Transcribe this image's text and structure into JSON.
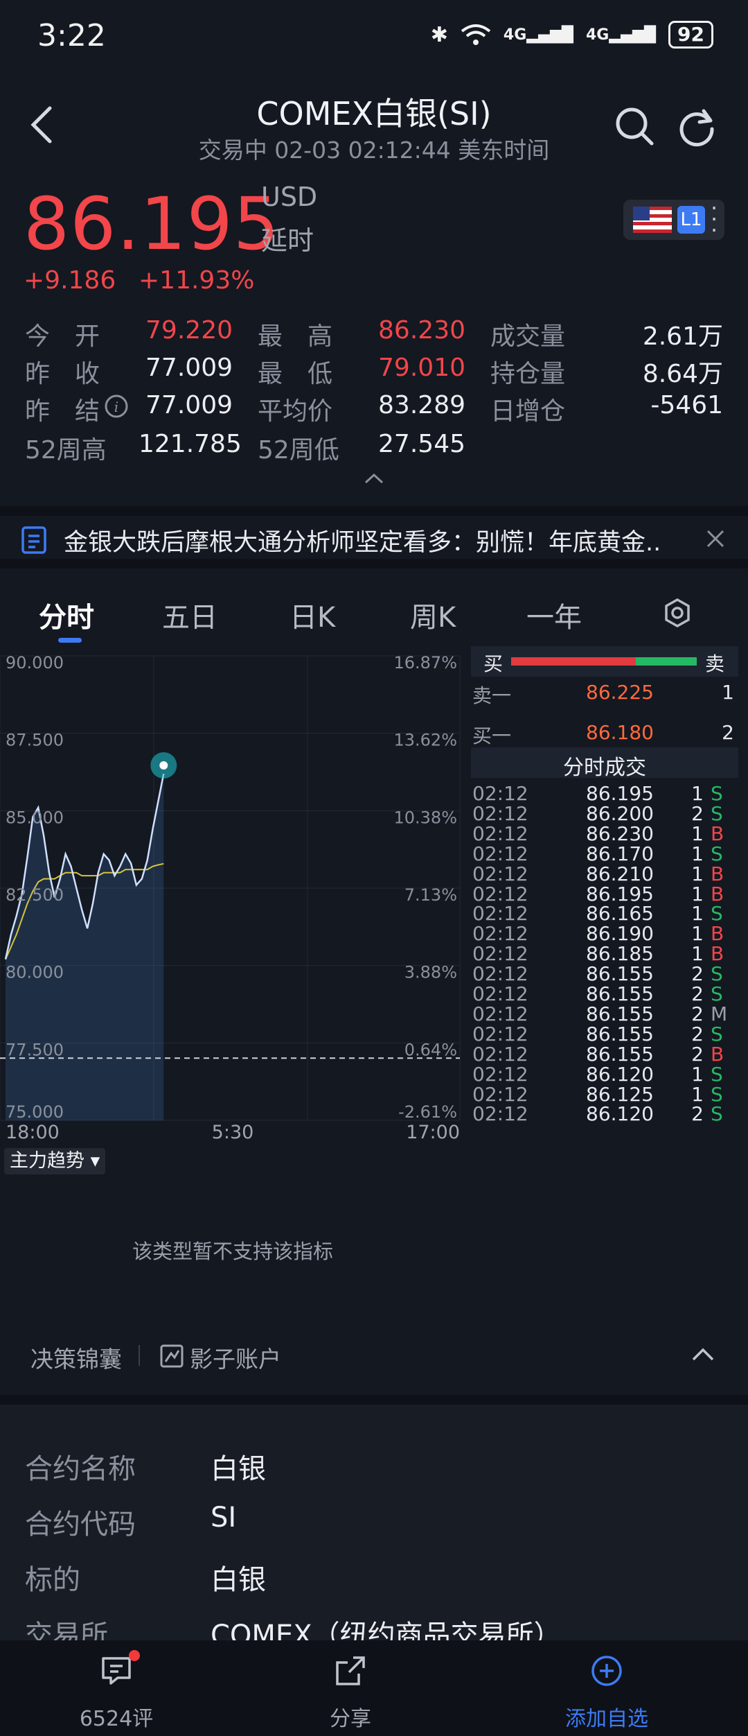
{
  "status": {
    "time": "3:22",
    "battery": "92",
    "net1": "4G",
    "net2": "4G"
  },
  "header": {
    "title": "COMEX白银(SI)",
    "subtitle": "交易中 02-03 02:12:44 美东时间"
  },
  "quote": {
    "price": "86.195",
    "currency": "USD",
    "delay": "延时",
    "change": "+9.186",
    "change_pct": "+11.93%",
    "badge_level": "L1"
  },
  "stats": {
    "open_label": "今　开",
    "open": "79.220",
    "high_label": "最　高",
    "high": "86.230",
    "volume_label": "成交量",
    "volume": "2.61万",
    "prev_close_label": "昨　收",
    "prev_close": "77.009",
    "low_label": "最　低",
    "low": "79.010",
    "oi_label": "持仓量",
    "oi": "8.64万",
    "prev_settle_label": "昨　结",
    "prev_settle": "77.009",
    "avg_label": "平均价",
    "avg": "83.289",
    "oi_change_label": "日增仓",
    "oi_change": "-5461",
    "w52_high_label": "52周高",
    "w52_high": "121.785",
    "w52_low_label": "52周低",
    "w52_low": "27.545"
  },
  "news": {
    "text": "金银大跌后摩根大通分析师坚定看多：别慌！年底黄金..."
  },
  "tabs": [
    "分时",
    "五日",
    "日K",
    "周K",
    "一年"
  ],
  "chart": {
    "y_labels": [
      "90.000",
      "87.500",
      "85.000",
      "82.500",
      "80.000",
      "77.500",
      "75.000"
    ],
    "pct_labels": [
      "16.87%",
      "13.62%",
      "10.38%",
      "7.13%",
      "3.88%",
      "0.64%",
      "-2.61%"
    ],
    "x_labels": [
      "18:00",
      "5:30",
      "17:00"
    ],
    "indicator_label": "主力趋势",
    "indicator_msg": "该类型暂不支持该指标"
  },
  "chart_data": {
    "type": "line",
    "x_range": [
      "18:00",
      "17:00"
    ],
    "ylim": [
      75.0,
      90.0
    ],
    "prev_settle": 77.009,
    "series": [
      {
        "values": [
          80.2,
          81.0,
          81.6,
          82.3,
          83.5,
          84.8,
          85.1,
          84.2,
          83.0,
          82.2,
          82.8,
          83.6,
          83.2,
          82.5,
          81.8,
          81.2,
          82.0,
          83.0,
          83.6,
          83.4,
          82.9,
          83.2,
          83.6,
          83.3,
          82.6,
          82.8,
          83.4,
          84.4,
          85.3,
          86.195
        ]
      },
      {
        "values": [
          80.2,
          80.6,
          81.0,
          81.5,
          82.0,
          82.4,
          82.7,
          82.8,
          82.8,
          82.8,
          82.9,
          83.0,
          83.0,
          83.0,
          82.9,
          82.9,
          82.9,
          82.9,
          83.0,
          83.0,
          83.0,
          83.0,
          83.1,
          83.1,
          83.1,
          83.1,
          83.1,
          83.2,
          83.25,
          83.289
        ]
      }
    ]
  },
  "orderbook": {
    "buy": "买",
    "sell": "卖",
    "ask_label": "卖一",
    "ask_price": "86.225",
    "ask_vol": "1",
    "bid_label": "买一",
    "bid_price": "86.180",
    "bid_vol": "2",
    "trades_title": "分时成交",
    "trades": [
      {
        "t": "02:12",
        "p": "86.195",
        "v": "1",
        "s": "S"
      },
      {
        "t": "02:12",
        "p": "86.200",
        "v": "2",
        "s": "S"
      },
      {
        "t": "02:12",
        "p": "86.230",
        "v": "1",
        "s": "B"
      },
      {
        "t": "02:12",
        "p": "86.170",
        "v": "1",
        "s": "S"
      },
      {
        "t": "02:12",
        "p": "86.210",
        "v": "1",
        "s": "B"
      },
      {
        "t": "02:12",
        "p": "86.195",
        "v": "1",
        "s": "B"
      },
      {
        "t": "02:12",
        "p": "86.165",
        "v": "1",
        "s": "S"
      },
      {
        "t": "02:12",
        "p": "86.190",
        "v": "1",
        "s": "B"
      },
      {
        "t": "02:12",
        "p": "86.185",
        "v": "1",
        "s": "B"
      },
      {
        "t": "02:12",
        "p": "86.155",
        "v": "2",
        "s": "S"
      },
      {
        "t": "02:12",
        "p": "86.155",
        "v": "2",
        "s": "S"
      },
      {
        "t": "02:12",
        "p": "86.155",
        "v": "2",
        "s": "M"
      },
      {
        "t": "02:12",
        "p": "86.155",
        "v": "2",
        "s": "S"
      },
      {
        "t": "02:12",
        "p": "86.155",
        "v": "2",
        "s": "B"
      },
      {
        "t": "02:12",
        "p": "86.120",
        "v": "1",
        "s": "S"
      },
      {
        "t": "02:12",
        "p": "86.125",
        "v": "1",
        "s": "S"
      },
      {
        "t": "02:12",
        "p": "86.120",
        "v": "2",
        "s": "S"
      }
    ]
  },
  "decision": {
    "left": "决策锦囊",
    "right": "影子账户"
  },
  "info": {
    "rows": [
      {
        "label": "合约名称",
        "value": "白银"
      },
      {
        "label": "合约代码",
        "value": "SI"
      },
      {
        "label": "标的",
        "value": "白银"
      },
      {
        "label": "交易所",
        "value": "COMEX（纽约商品交易所）"
      }
    ]
  },
  "nav": {
    "comments": "6524评",
    "share": "分享",
    "add": "添加自选"
  },
  "colors": {
    "up": "#f2464a",
    "down": "#25b864",
    "accent": "#3d7bf5",
    "line": "#cfe0ff",
    "avg": "#d8c33a"
  }
}
